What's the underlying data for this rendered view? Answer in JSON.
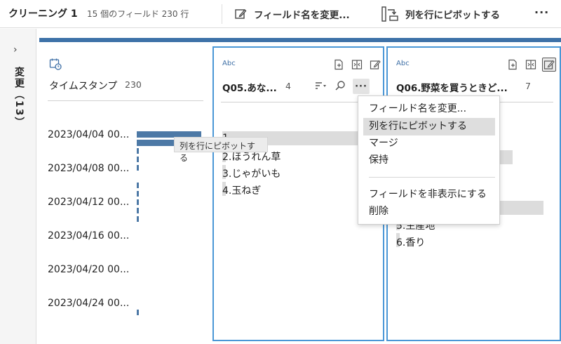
{
  "header": {
    "title": "クリーニング 1",
    "subtitle": "15 個のフィールド  230 行",
    "rename_label": "フィールド名を変更...",
    "pivot_label": "列を行にピボットする",
    "more_label": "···"
  },
  "left_panel": {
    "expand_glyph": "›",
    "changes_label": "変更（13）"
  },
  "cards": [
    {
      "type": "date",
      "name": "タイムスタンプ",
      "count": "230",
      "dates": [
        "2023/04/04 00...",
        "2023/04/08 00...",
        "2023/04/12 00...",
        "2023/04/16 00...",
        "2023/04/20 00...",
        "2023/04/24 00..."
      ],
      "histogram_values": [
        28,
        28,
        1,
        1,
        1,
        0,
        1,
        1,
        1,
        1,
        1,
        0,
        0,
        0,
        0,
        0,
        0,
        0,
        0,
        0,
        0,
        1
      ]
    },
    {
      "type": "Abc",
      "name": "Q05.あな...",
      "count": "4",
      "values": [
        "1.",
        "2.ほうれん草",
        "3.じゃがいも",
        "4.玉ねぎ"
      ]
    },
    {
      "type": "Abc",
      "name": "Q06.野菜を買うときど...",
      "count": "7",
      "values": [
        "5.生産地",
        "6.香り"
      ]
    }
  ],
  "tooltip": "列を行にピボットする",
  "context_menu": {
    "items": [
      "フィールド名を変更...",
      "列を行にピボットする",
      "マージ",
      "保持",
      "フィールドを非表示にする",
      "削除"
    ],
    "highlighted_index": 1
  },
  "colors": {
    "accent": "#3e72a8",
    "selection_border": "#4a97d6",
    "histogram_bar": "#4d79a6"
  }
}
